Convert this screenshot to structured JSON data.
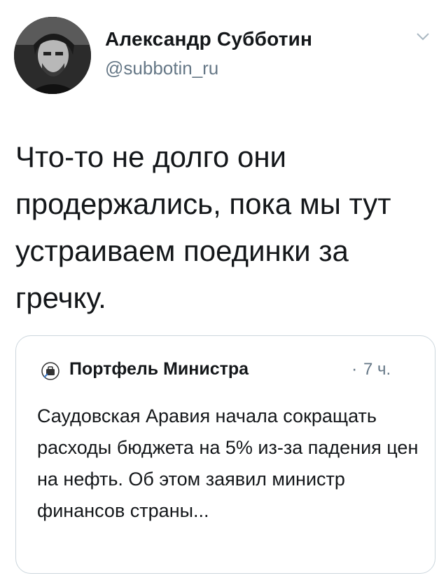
{
  "author": {
    "name": "Александр Субботин",
    "handle": "@subbotin_ru",
    "avatar_icon": "user-avatar-photo"
  },
  "menu_icon": "chevron-down-icon",
  "tweet": {
    "text": "Что-то не долго они продержались, пока мы тут устраиваем поединки за гречку."
  },
  "quoted_tweet": {
    "author_name": "Портфель Министра",
    "separator": "·",
    "time": "7 ч.",
    "avatar_icon": "portfolio-logo-icon",
    "text": "Саудовская Аравия начала сокращать расходы бюджета на 5% из-за падения цен на нефть. Об этом заявил министр финансов страны..."
  },
  "colors": {
    "text_primary": "#14171a",
    "text_secondary": "#657786",
    "border": "#ccd6dd"
  }
}
